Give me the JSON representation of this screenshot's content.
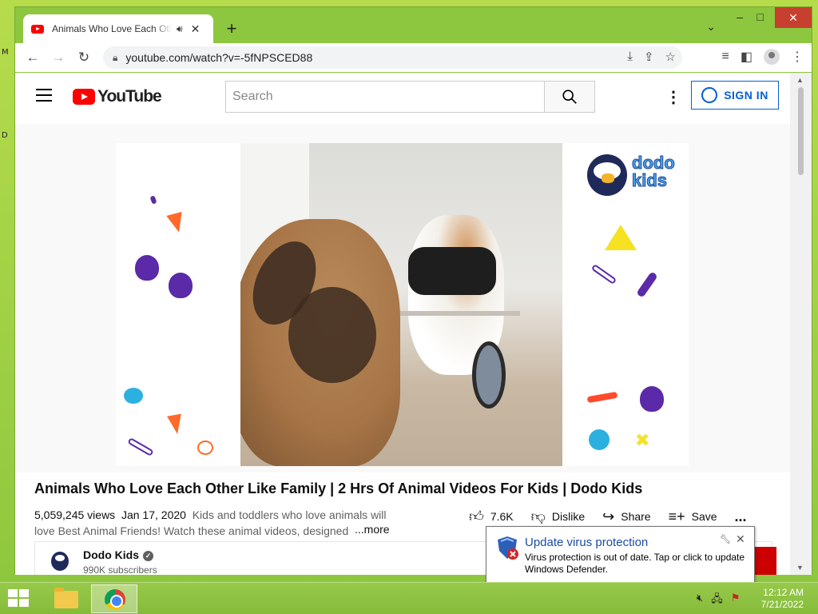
{
  "browser": {
    "tab_title": "Animals Who Love Each Other Like Family | 2 Hrs Of Animal Videos For Kids",
    "url": "youtube.com/watch?v=-5fNPSCED88",
    "new_tab_symbol": "+",
    "window_controls": {
      "minimize": "–",
      "maximize": "□",
      "close": "✕"
    }
  },
  "youtube": {
    "logo_text": "YouTube",
    "search_placeholder": "Search",
    "sign_in_label": "SIGN IN",
    "video": {
      "brand_logo_text": "dodo kids",
      "title": "Animals Who Love Each Other Like Family | 2 Hrs Of Animal Videos For Kids | Dodo Kids",
      "views": "5,059,245 views",
      "date": "Jan 17, 2020",
      "description": "Kids and toddlers who love animals will love Best Animal Friends! Watch these animal videos, designed",
      "more_label": "...more",
      "likes": "7.6K",
      "dislike_label": "Dislike",
      "share_label": "Share",
      "save_label": "Save",
      "overflow": "..."
    },
    "channel": {
      "name": "Dodo Kids",
      "subscribers": "990K subscribers"
    }
  },
  "notification": {
    "title": "Update virus protection",
    "body": "Virus protection is out of date. Tap or click to update Windows Defender."
  },
  "taskbar": {
    "time": "12:12 AM",
    "date": "7/21/2022"
  },
  "colors": {
    "desktop": "#8dc63f",
    "youtube_red": "#ff0000",
    "link_blue": "#065fd4"
  }
}
